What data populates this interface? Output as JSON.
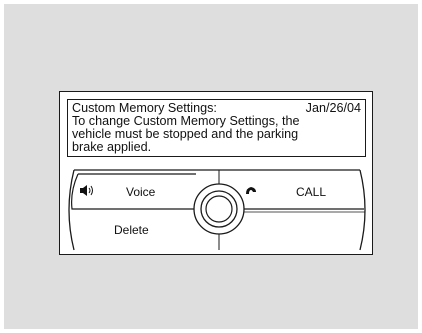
{
  "screen": {
    "title": "Custom Memory Settings:",
    "date": "Jan/26/04",
    "message": "To change Custom Memory Settings, the\nvehicle must be stopped and the parking\nbrake applied."
  },
  "buttons": {
    "voice_label": "Voice",
    "call_label": "CALL",
    "delete_label": "Delete"
  },
  "icons": {
    "voice_icon": "speaker-icon",
    "call_icon": "phone-handset-icon",
    "center_icon": "joystick-knob-icon"
  }
}
